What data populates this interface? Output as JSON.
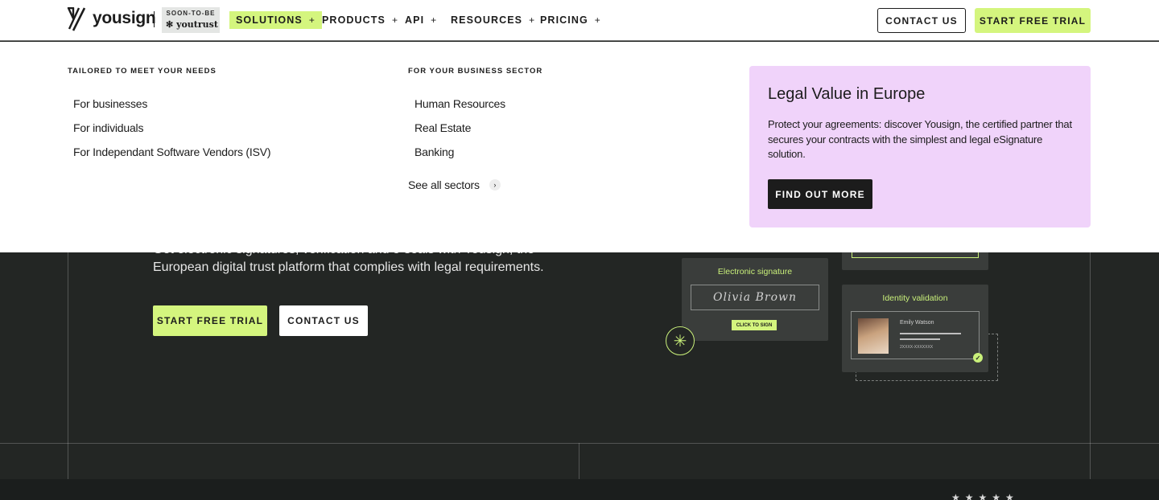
{
  "header": {
    "logo_text": "yousign",
    "badge_top": "SOON-TO-BE",
    "badge_bottom": "youtrust",
    "nav": [
      {
        "label": "SOLUTIONS",
        "icon": "+"
      },
      {
        "label": "PRODUCTS",
        "icon": "+"
      },
      {
        "label": "API",
        "icon": "+"
      },
      {
        "label": "RESOURCES",
        "icon": "+"
      },
      {
        "label": "PRICING",
        "icon": "+"
      }
    ],
    "contact_label": "CONTACT US",
    "trial_label": "START FREE TRIAL"
  },
  "mega_menu": {
    "col1": {
      "heading": "TAILORED TO MEET YOUR NEEDS",
      "links": [
        "For businesses",
        "For individuals",
        "For Independant Software Vendors (ISV)"
      ]
    },
    "col2": {
      "heading": "FOR YOUR BUSINESS SECTOR",
      "links": [
        "Human Resources",
        "Real Estate",
        "Banking"
      ],
      "see_all": "See all sectors",
      "see_all_icon": "›"
    },
    "promo": {
      "title": "Legal Value in Europe",
      "text": "Protect your agreements: discover Yousign, the certified partner that secures your contracts with the simplest and legal eSignature solution.",
      "button": "FIND OUT MORE"
    }
  },
  "hero": {
    "subtitle": "Get electronic signatures, verification and e-seals with Yousign, the European digital trust platform that complies with legal requirements.",
    "trial_label": "START FREE TRIAL",
    "contact_label": "CONTACT US",
    "signature_card": {
      "title": "Electronic signature",
      "name": "Olivia Brown",
      "button": "CLICK TO SIGN"
    },
    "identity_card": {
      "title": "Identity validation",
      "name": "Emily Watson",
      "number": "2XXXX-XXXXXXX"
    },
    "stars": "★★★★★"
  },
  "colors": {
    "accent_green": "#d4f57e",
    "promo_pink": "#f0d3fa",
    "hero_bg": "#232624"
  }
}
